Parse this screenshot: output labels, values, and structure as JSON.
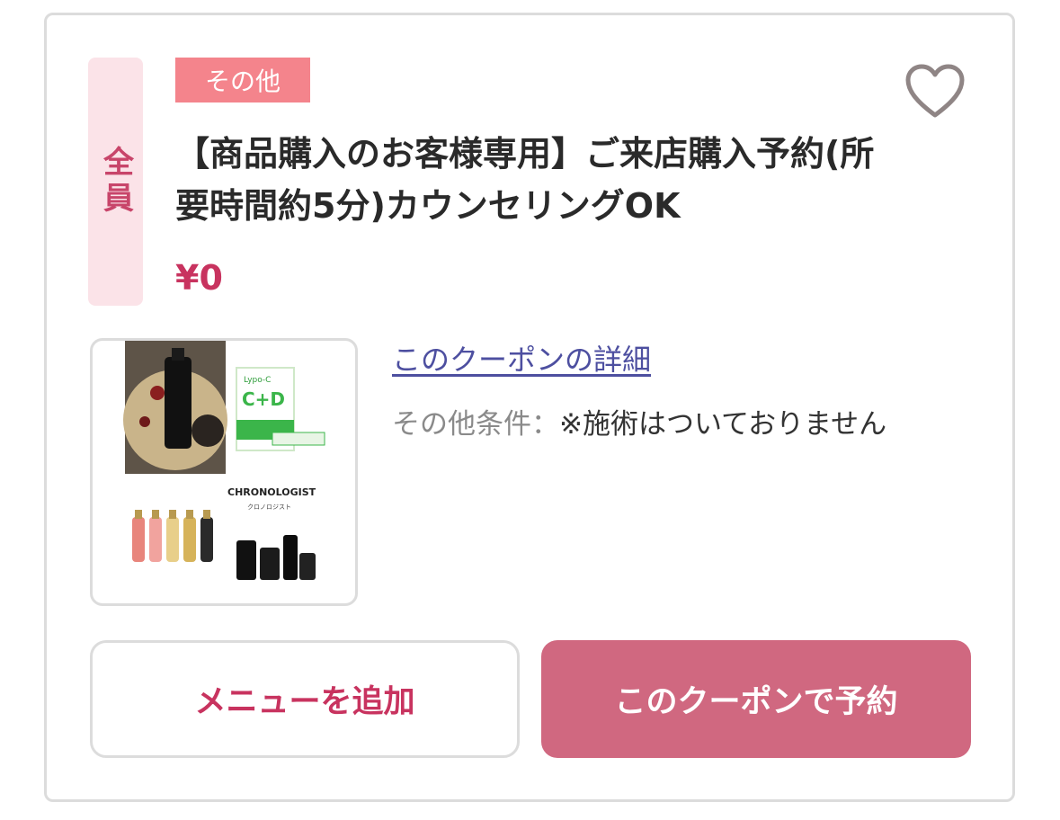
{
  "coupon": {
    "target": "全員",
    "category": "その他",
    "title": "【商品購入のお客様専用】ご来店購入予約(所要時間約5分)カウンセリングOK",
    "price": "¥0",
    "detail_link": "このクーポンの詳細",
    "conditions_label": "その他条件：",
    "conditions_value": "※施術はついておりません",
    "favorite_icon": "heart-outline-icon",
    "image": {
      "top_right_label": "C+D",
      "top_right_brand": "Lypo-C",
      "bottom_brand": "CHRONOLOGIST",
      "bottom_brand_sub": "クロノロジスト"
    }
  },
  "actions": {
    "add_menu": "メニューを追加",
    "reserve": "このクーポンで予約"
  },
  "colors": {
    "accent": "#c8335f",
    "badge_bg": "#fbe3e8",
    "tag_bg": "#f4848c",
    "reserve_button": "#d06880",
    "link": "#4d4fa0"
  }
}
